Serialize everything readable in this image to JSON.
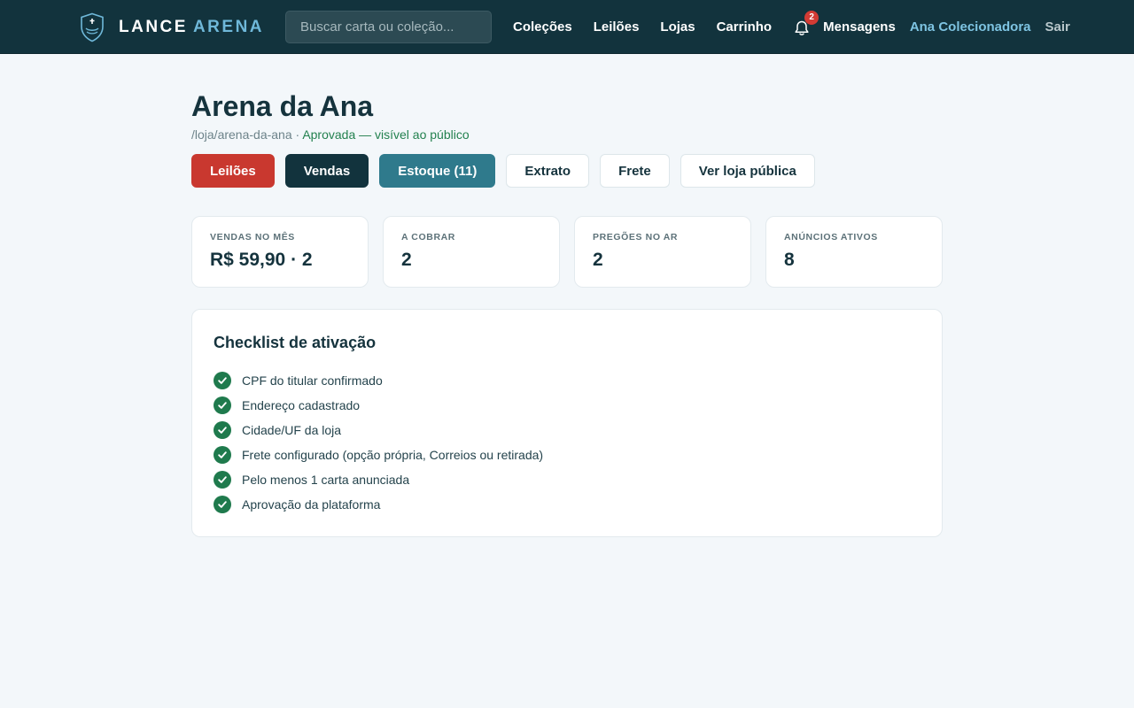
{
  "header": {
    "logo_word1": "LANCE",
    "logo_word2": "ARENA",
    "search_placeholder": "Buscar carta ou coleção...",
    "nav": {
      "colecoes": "Coleções",
      "leiloes": "Leilões",
      "lojas": "Lojas",
      "carrinho": "Carrinho"
    },
    "notifications_count": "2",
    "messages": "Mensagens",
    "user": "Ana Colecionadora",
    "logout": "Sair"
  },
  "store": {
    "title": "Arena da Ana",
    "slug": "/loja/arena-da-ana",
    "separator": " · ",
    "status": "Aprovada — visível ao público"
  },
  "tabs": {
    "leiloes": "Leilões",
    "vendas": "Vendas",
    "estoque": "Estoque (11)",
    "extrato": "Extrato",
    "frete": "Frete",
    "ver_loja": "Ver loja pública"
  },
  "stats": [
    {
      "label": "VENDAS NO MÊS",
      "value": "R$ 59,90 · 2"
    },
    {
      "label": "A COBRAR",
      "value": "2"
    },
    {
      "label": "PREGÕES NO AR",
      "value": "2"
    },
    {
      "label": "ANÚNCIOS ATIVOS",
      "value": "8"
    }
  ],
  "checklist": {
    "title": "Checklist de ativação",
    "items": [
      "CPF do titular confirmado",
      "Endereço cadastrado",
      "Cidade/UF da loja",
      "Frete configurado (opção própria, Correios ou retirada)",
      "Pelo menos 1 carta anunciada",
      "Aprovação da plataforma"
    ]
  },
  "icons": {
    "logo": "shield-logo-icon",
    "notifications": "bell-icon",
    "check": "check-circle-icon"
  },
  "colors": {
    "header_bg": "#12333d",
    "accent_blue": "#6fb8d9",
    "tab_red": "#c9382f",
    "tab_dark": "#12333d",
    "tab_teal": "#2f7a8c",
    "success_green": "#1f7a4d",
    "badge_red": "#d23b34"
  }
}
